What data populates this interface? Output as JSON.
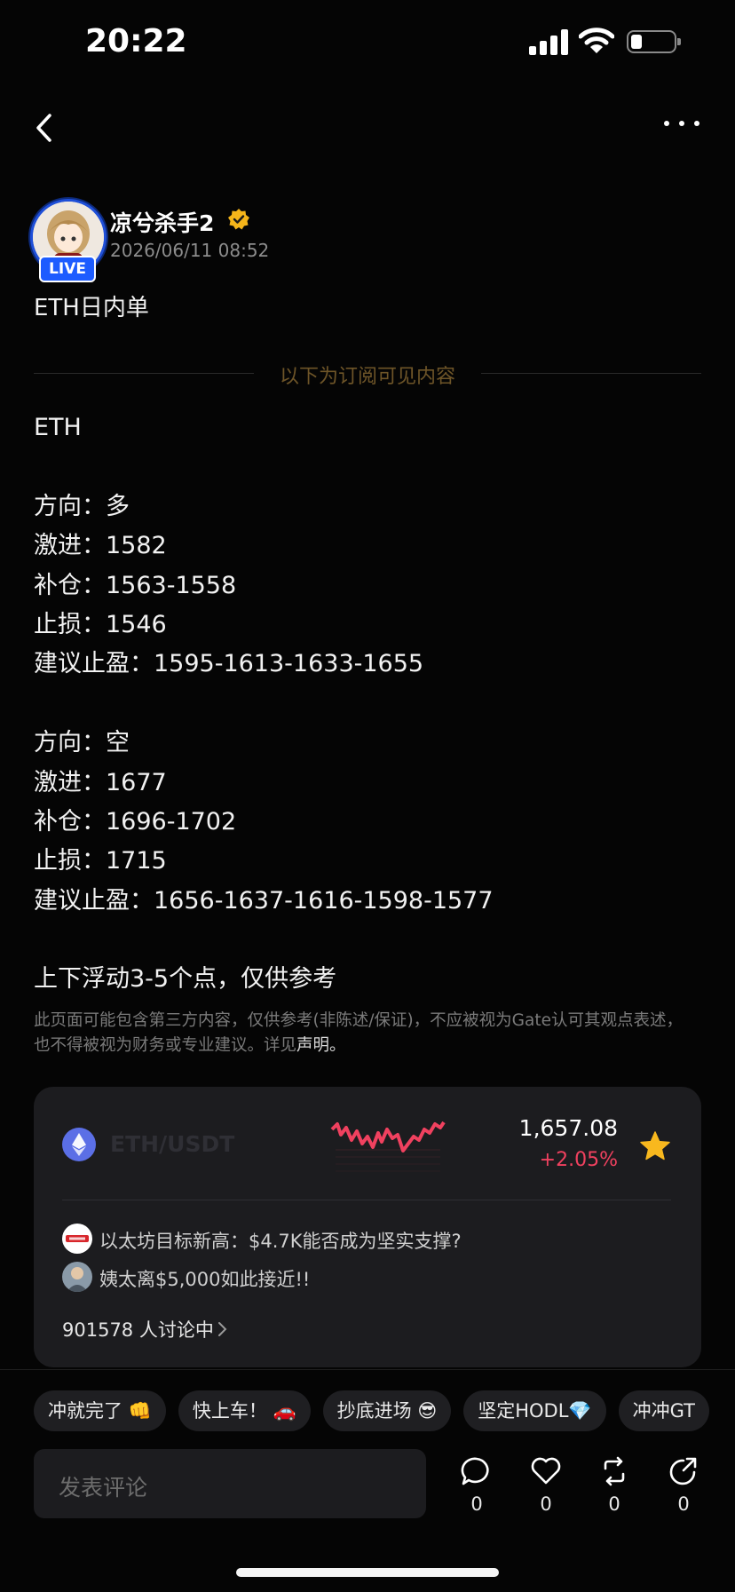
{
  "status_bar": {
    "time": "20:22",
    "battery_fraction": 0.22
  },
  "author": {
    "name": "凉兮杀手2",
    "live_badge": "LIVE",
    "post_time": "2026/06/11 08:52"
  },
  "post": {
    "title": "ETH日内单",
    "subscriber_divider": "以下为订阅可见内容",
    "body_lines": [
      "ETH",
      "",
      "方向：多",
      "激进：1582",
      "补仓：1563-1558",
      "止损：1546",
      "建议止盈：1595-1613-1633-1655",
      "",
      "方向：空",
      "激进：1677",
      "补仓：1696-1702",
      "止损：1715",
      "建议止盈：1656-1637-1616-1598-1577",
      "",
      "上下浮动3-5个点，仅供参考"
    ],
    "disclaimer": "此页面可能包含第三方内容，仅供参考(非陈述/保证)，不应被视为Gate认可其观点表述，也不得被视为财务或专业建议。详见",
    "disclaimer_link": "声明。"
  },
  "market_card": {
    "pair": "ETH/USDT",
    "price": "1,657.08",
    "change": "+2.05%",
    "colors": {
      "up": "#f0415f",
      "star": "#f8b81e",
      "eth": "#5b6fe6"
    },
    "news": [
      {
        "icon": "news-source-icon",
        "text": "以太坊目标新高：$4.7K能否成为坚实支撑?"
      },
      {
        "icon": "user-avatar-icon",
        "text": "姨太离$5,000如此接近!!"
      }
    ],
    "discussion": "901578 人讨论中"
  },
  "quick_tags": [
    "冲就完了 👊",
    "快上车！ 🚗",
    "抄底进场 😎",
    "坚定HODL💎",
    "冲冲GT"
  ],
  "comment_placeholder": "发表评论",
  "actions": [
    {
      "icon": "comment-icon",
      "count": "0"
    },
    {
      "icon": "like-icon",
      "count": "0"
    },
    {
      "icon": "repost-icon",
      "count": "0"
    },
    {
      "icon": "share-icon",
      "count": "0"
    }
  ]
}
